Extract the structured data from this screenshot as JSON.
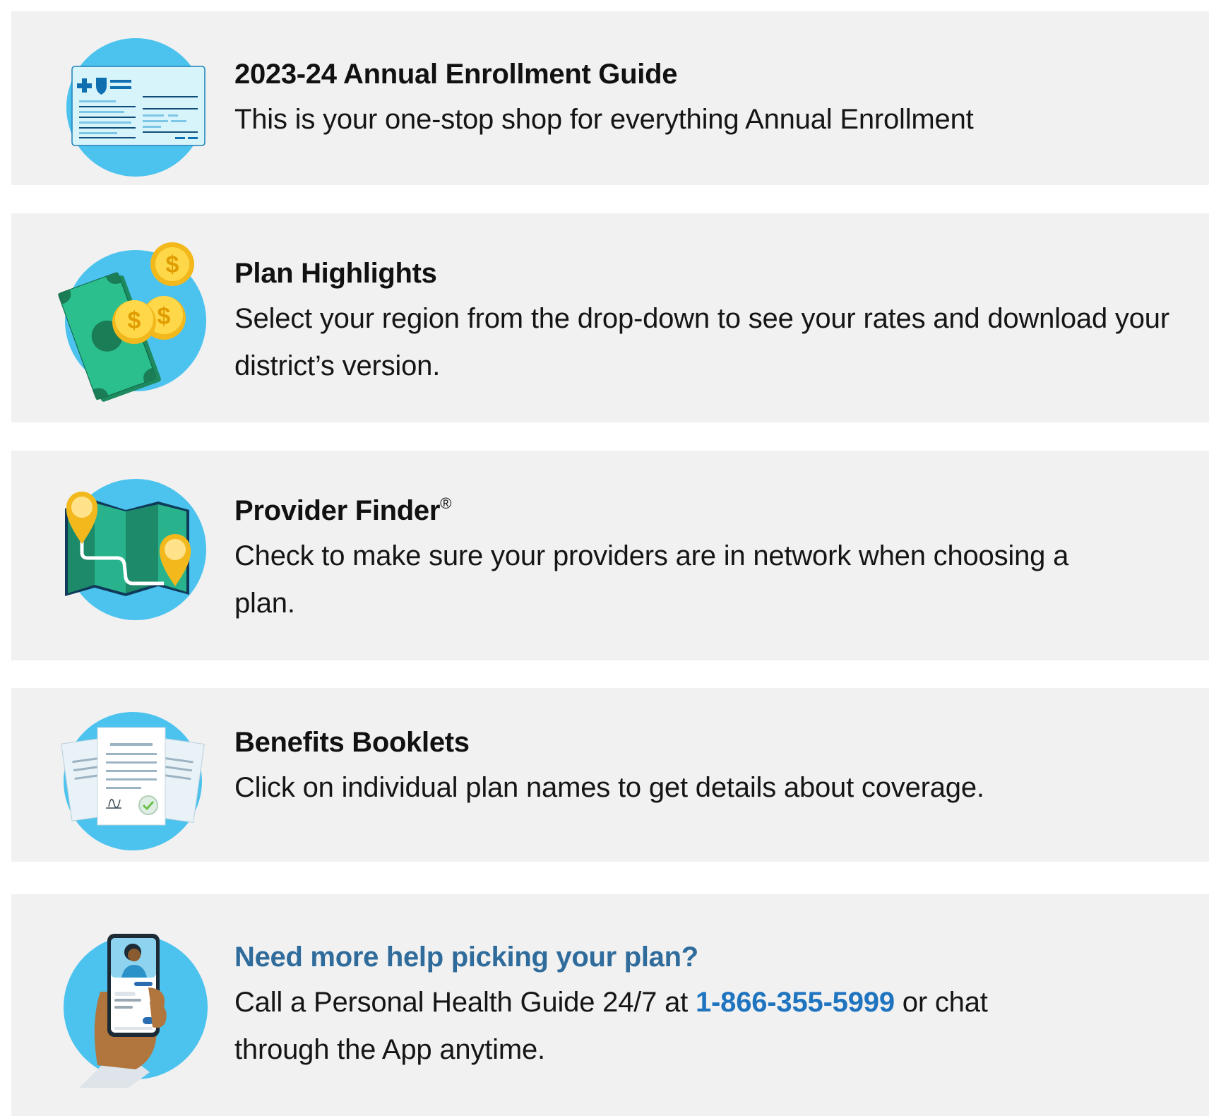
{
  "colors": {
    "card_background": "#f1f1f1",
    "icon_circle": "#4cc3ee",
    "help_title": "#2f6c9c",
    "phone_link": "#1f74c0"
  },
  "cards": [
    {
      "icon": "insurance-card-icon",
      "title": "2023-24 Annual Enrollment Guide",
      "description": "This is your one-stop shop for everything Annual Enrollment"
    },
    {
      "icon": "money-coins-icon",
      "title": "Plan Highlights",
      "description": "Select your region from the drop-down to see your rates and download your district’s version."
    },
    {
      "icon": "map-pins-icon",
      "title": "Provider Finder",
      "title_mark": "®",
      "description": "Check to make sure your providers are in network when choosing a plan."
    },
    {
      "icon": "documents-icon",
      "title": "Benefits Booklets",
      "description": "Click on individual plan names to get details about coverage."
    }
  ],
  "help": {
    "icon": "phone-chat-icon",
    "title": "Need more help picking your plan?",
    "desc_before": "Call a Personal Health Guide 24/7 at ",
    "phone": "1-866-355-5999",
    "desc_after": " or chat through the App anytime."
  }
}
